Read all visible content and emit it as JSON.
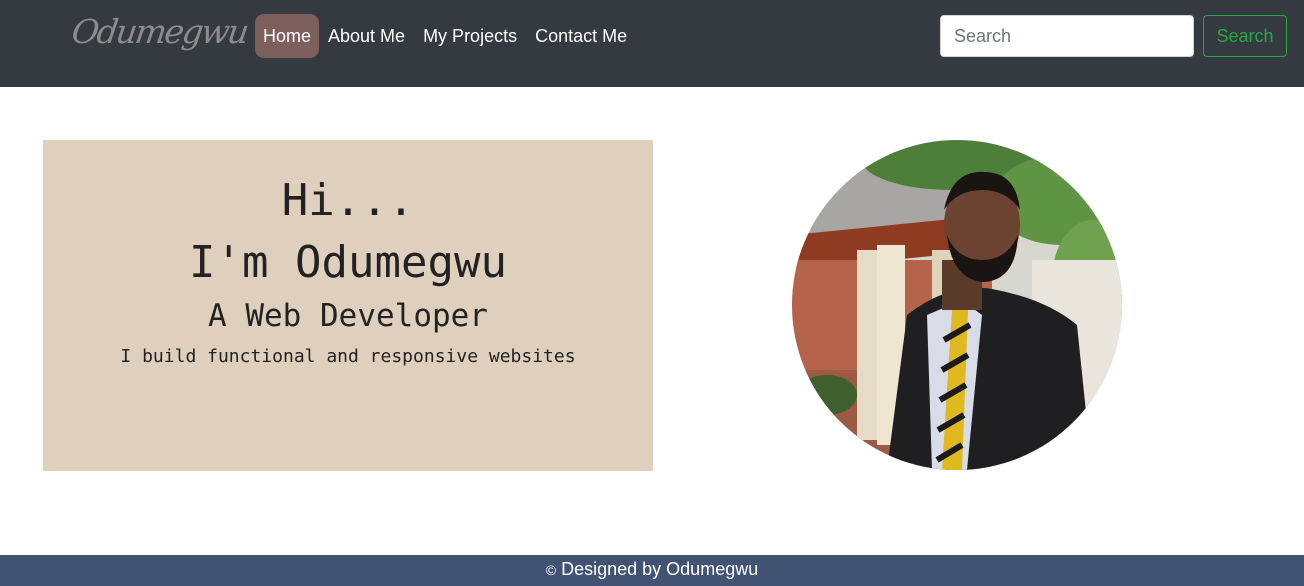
{
  "navbar": {
    "brand": "Odumegwu",
    "links": [
      {
        "label": "Home",
        "active": true
      },
      {
        "label": "About Me",
        "active": false
      },
      {
        "label": "My Projects",
        "active": false
      },
      {
        "label": "Contact Me",
        "active": false
      }
    ],
    "search": {
      "placeholder": "Search",
      "button_label": "Search"
    }
  },
  "hero": {
    "greeting": "Hi...",
    "name": "I'm Odumegwu",
    "role": "A Web Developer",
    "tagline": "I build functional and responsive websites"
  },
  "footer": {
    "copyright_symbol": "©",
    "text": "Designed by Odumegwu"
  },
  "colors": {
    "navbar_bg": "#343a40",
    "active_link_bg": "#7d5f5c",
    "hero_card_bg": "#dfd0bd",
    "search_button": "#28a745",
    "footer_bg": "#425272"
  }
}
